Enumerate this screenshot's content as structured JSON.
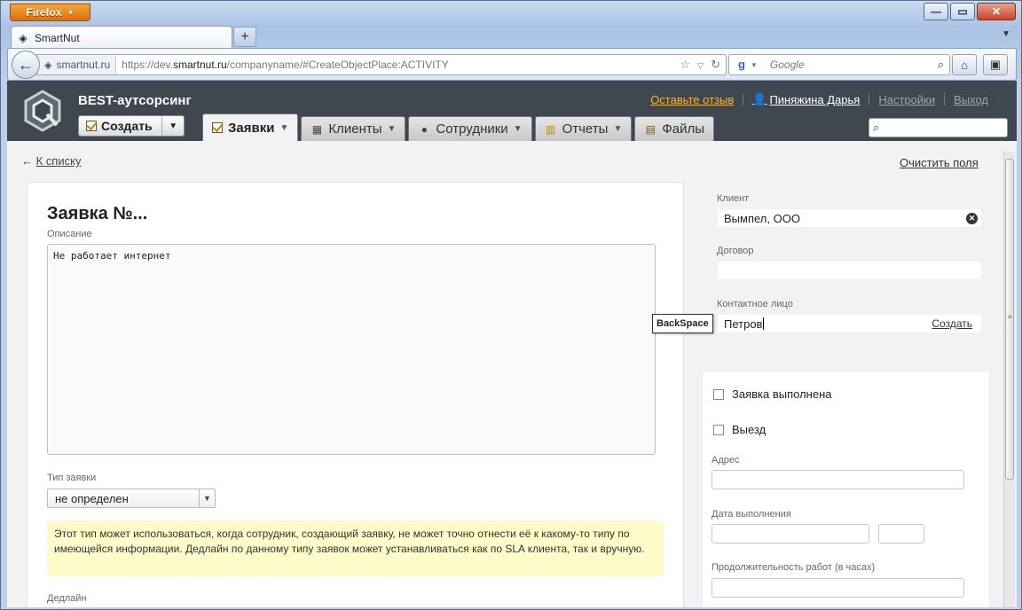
{
  "browser": {
    "app_button": "Firefox",
    "tab_title": "SmartNut",
    "new_tab": "+",
    "site_identity": "smartnut.ru",
    "url_prefix": "https://dev.",
    "url_domain": "smartnut.ru",
    "url_path": "/companyname/#CreateObjectPlace:ACTIVITY",
    "search_placeholder": "Google"
  },
  "app": {
    "brand": "BEST-аутсорсинг",
    "create_label": "Создать",
    "links": {
      "feedback": "Оставьте отзыв",
      "user": "Пиняжина Дарья",
      "settings": "Настройки",
      "logout": "Выход"
    },
    "tabs": [
      {
        "label": "Заявки",
        "icon": "check-icon"
      },
      {
        "label": "Клиенты",
        "icon": "building-icon"
      },
      {
        "label": "Сотрудники",
        "icon": "person-icon"
      },
      {
        "label": "Отчеты",
        "icon": "chart-icon"
      },
      {
        "label": "Файлы",
        "icon": "file-icon"
      }
    ]
  },
  "page": {
    "back_link": "К списку",
    "clear_link": "Очистить поля",
    "title": "Заявка №...",
    "description_label": "Описание",
    "description_value": "Не работает интернет",
    "type_label": "Тип заявки",
    "type_value": "не определен",
    "hint": "Этот тип может использоваться, когда сотрудник, создающий заявку, не может точно отнести её к какому-то типу по имеющейся информации. Дедлайн по данному типу заявок может устанавливаться как по SLA клиента, так и вручную.",
    "deadline_label": "Дедлайн"
  },
  "side": {
    "client_label": "Клиент",
    "client_value": "Вымпел, ООО",
    "contract_label": "Договор",
    "contact_label": "Контактное лицо",
    "contact_value": "Петров",
    "contact_create": "Создать",
    "key_tooltip": "BackSpace",
    "done_label": "Заявка выполнена",
    "trip_label": "Выезд",
    "address_label": "Адрес",
    "date_label": "Дата выполнения",
    "duration_label": "Продолжительность работ (в часах)"
  },
  "colors": {
    "header_bg": "#3f4850",
    "feedback_link": "#f0b43c",
    "hint_bg": "#fdfbc8",
    "firefox_orange": "#e06e0a"
  }
}
